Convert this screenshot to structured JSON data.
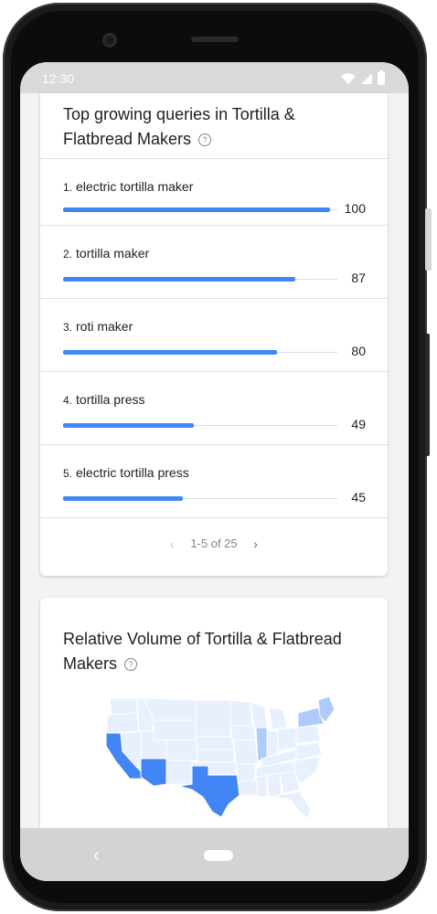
{
  "status_bar": {
    "time": "12:30"
  },
  "queries_card": {
    "title": "Top growing queries in Tortilla & Flatbread Makers",
    "help_icon": "?",
    "items": [
      {
        "rank": "1.",
        "label": "electric tortilla maker",
        "value": "100",
        "level": 100
      },
      {
        "rank": "2.",
        "label": "tortilla maker",
        "value": "87",
        "level": 87
      },
      {
        "rank": "3.",
        "label": "roti maker",
        "value": "80",
        "level": 80
      },
      {
        "rank": "4.",
        "label": "tortilla press",
        "value": "49",
        "level": 49
      },
      {
        "rank": "5.",
        "label": "electric tortilla press",
        "value": "45",
        "level": 45
      }
    ],
    "pagination": {
      "prev": "‹",
      "text": "1-5 of 25",
      "next": "›"
    }
  },
  "volume_card": {
    "title": "Relative Volume of Tortilla & Flatbread Makers",
    "help_icon": "?",
    "map_colors": {
      "high": "#4285f4",
      "mid": "#aecbfa",
      "low": "#e8f0fe",
      "border": "#ffffff"
    }
  },
  "nav_bar": {
    "back": "‹"
  }
}
